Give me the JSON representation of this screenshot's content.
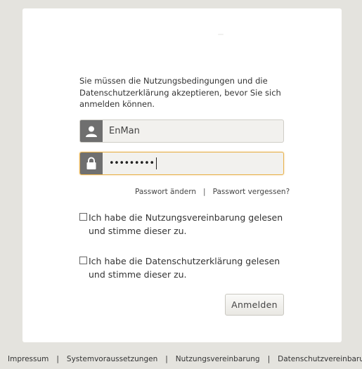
{
  "notice": "Sie müssen die Nutzungsbedingungen und die Datenschutzerklärung akzeptieren, bevor Sie sich anmelden können.",
  "username": {
    "value": "EnMan",
    "icon": "user-icon"
  },
  "password": {
    "value": "•••••••••",
    "icon": "lock-icon"
  },
  "links": {
    "change_password": "Passwort ändern",
    "separator": "|",
    "forgot_password": "Passwort vergessen?"
  },
  "consent_terms": {
    "line1": "Ich habe die Nutzungsvereinbarung gelesen",
    "line2": "und stimme dieser zu."
  },
  "consent_privacy": {
    "line1": "Ich habe die Datenschutzerklärung gelesen",
    "line2": "und stimme dieser zu."
  },
  "login_button": "Anmelden",
  "footer": {
    "items": [
      "Impressum",
      "Systemvoraussetzungen",
      "Nutzungsvereinbarung",
      "Datenschutzvereinbarung"
    ],
    "separator": "|"
  },
  "colors": {
    "background": "#e4e3de",
    "card": "#ffffff",
    "icon_bg": "#6f6f6f",
    "focus_border": "#e8b24e"
  }
}
